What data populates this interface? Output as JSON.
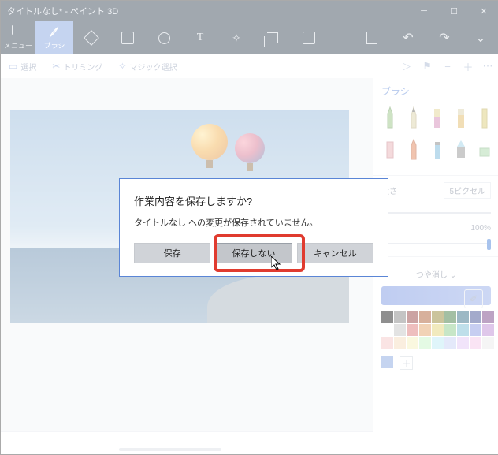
{
  "window": {
    "title": "タイトルなし* - ペイント 3D"
  },
  "ribbon": {
    "menu": "メニュー",
    "brush": "ブラシ"
  },
  "toolbar2": {
    "select": "選択",
    "trimming": "トリミング",
    "magic": "マジック選択"
  },
  "panel": {
    "heading": "ブラシ",
    "thickness_label": "太さ",
    "thickness_value": "5ピクセル",
    "opacity_value": "100%",
    "matte_label": "つや消し"
  },
  "swatches": [
    "#000000",
    "#7a7a7a",
    "#8a2f2f",
    "#a54b1f",
    "#8a7a1f",
    "#2f6d2f",
    "#1f5f7a",
    "#2f3f8a",
    "#6a2f7a",
    "#ffffff",
    "#bfbfbf",
    "#d96b6b",
    "#e09a5a",
    "#e0d06b",
    "#7fc77f",
    "#6bb7d0",
    "#7f8fe0",
    "#b77fd0",
    "#f4c2c2",
    "#f4d8b6",
    "#f4eeb6",
    "#c2f4c2",
    "#b6e8f4",
    "#c2ccf4",
    "#e0c2f4",
    "#f4c2e6",
    "#e8e8e8"
  ],
  "dialog": {
    "title": "作業内容を保存しますか?",
    "message": "タイトルなし への変更が保存されていません。",
    "save": "保存",
    "dont_save": "保存しない",
    "cancel": "キャンセル"
  }
}
